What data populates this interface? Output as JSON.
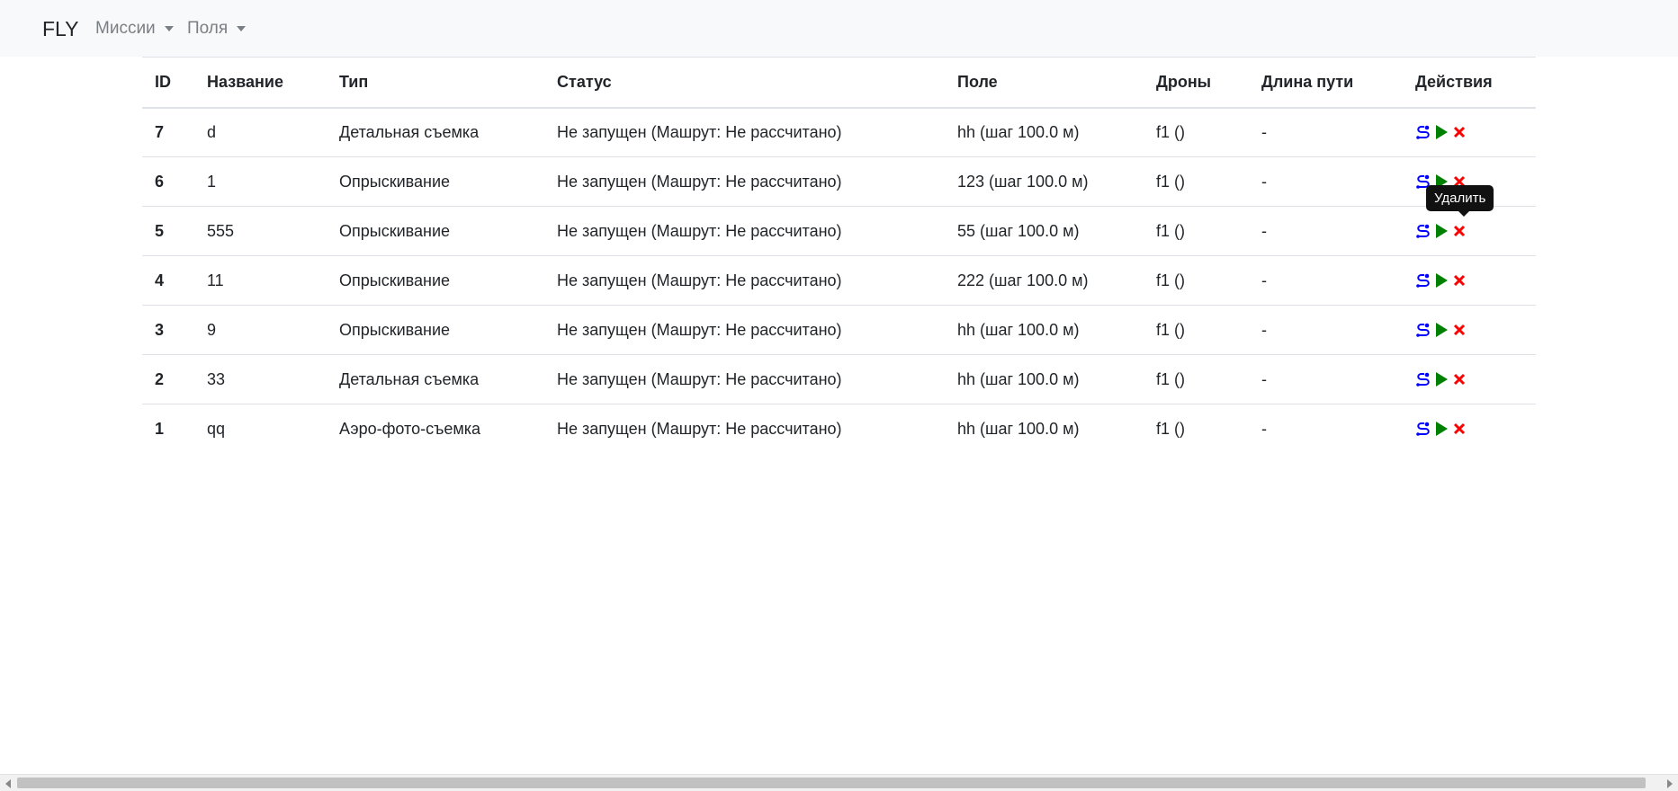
{
  "navbar": {
    "brand": "FLY",
    "menus": [
      {
        "label": "Миссии"
      },
      {
        "label": "Поля"
      }
    ]
  },
  "table": {
    "headers": [
      "ID",
      "Название",
      "Тип",
      "Статус",
      "Поле",
      "Дроны",
      "Длина пути",
      "Действия"
    ],
    "rows": [
      {
        "id": "7",
        "name": "d",
        "type": "Детальная съемка",
        "status": "Не запущен (Машрут: Не рассчитано)",
        "field": "hh (шаг 100.0 м)",
        "drones": "f1 ()",
        "length": "-"
      },
      {
        "id": "6",
        "name": "1",
        "type": "Опрыскивание",
        "status": "Не запущен (Машрут: Не рассчитано)",
        "field": "123 (шаг 100.0 м)",
        "drones": "f1 ()",
        "length": "-"
      },
      {
        "id": "5",
        "name": "555",
        "type": "Опрыскивание",
        "status": "Не запущен (Машрут: Не рассчитано)",
        "field": "55 (шаг 100.0 м)",
        "drones": "f1 ()",
        "length": "-"
      },
      {
        "id": "4",
        "name": "11",
        "type": "Опрыскивание",
        "status": "Не запущен (Машрут: Не рассчитано)",
        "field": "222 (шаг 100.0 м)",
        "drones": "f1 ()",
        "length": "-"
      },
      {
        "id": "3",
        "name": "9",
        "type": "Опрыскивание",
        "status": "Не запущен (Машрут: Не рассчитано)",
        "field": "hh (шаг 100.0 м)",
        "drones": "f1 ()",
        "length": "-"
      },
      {
        "id": "2",
        "name": "33",
        "type": "Детальная съемка",
        "status": "Не запущен (Машрут: Не рассчитано)",
        "field": "hh (шаг 100.0 м)",
        "drones": "f1 ()",
        "length": "-"
      },
      {
        "id": "1",
        "name": "qq",
        "type": "Аэро-фото-съемка",
        "status": "Не запущен (Машрут: Не рассчитано)",
        "field": "hh (шаг 100.0 м)",
        "drones": "f1 ()",
        "length": "-"
      }
    ],
    "action_icons": {
      "route": {
        "icon": "route-icon",
        "color": "#0000ff"
      },
      "start": {
        "icon": "play-icon",
        "color": "#008000"
      },
      "delete": {
        "icon": "close-icon",
        "color": "#ff0000"
      }
    }
  },
  "tooltip": {
    "text": "Удалить"
  }
}
